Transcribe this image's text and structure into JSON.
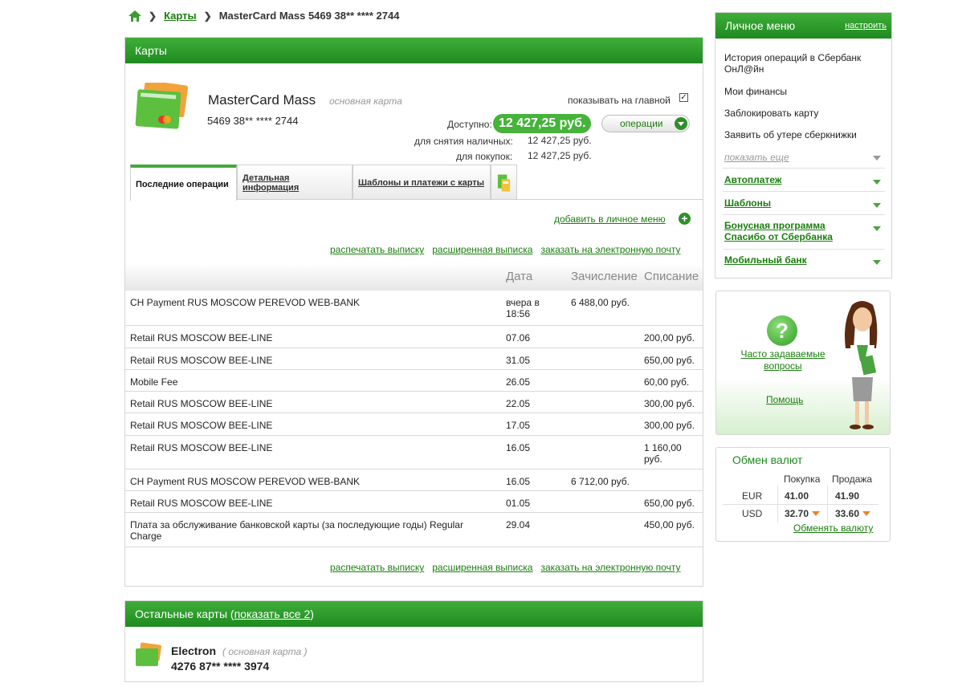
{
  "breadcrumb": {
    "cards_link": "Карты",
    "current": "MasterCard Mass 5469 38** **** 2744"
  },
  "main_panel": {
    "title": "Карты",
    "card_name": "MasterCard Mass",
    "card_type": "основная карта",
    "card_number": "5469 38** **** 2744",
    "show_on_main_label": "показывать на главной",
    "available_label": "Доступно:",
    "available_value": "12 427,25 руб.",
    "operations_button": "операции",
    "cash_label": "для снятия наличных:",
    "cash_value": "12 427,25 руб.",
    "purchase_label": "для покупок:",
    "purchase_value": "12 427,25 руб.",
    "tabs": [
      {
        "label": "Последние операции"
      },
      {
        "label": "Детальная информация"
      },
      {
        "label": "Шаблоны и платежи с карты"
      }
    ],
    "add_to_menu": "добавить в личное меню",
    "links": {
      "print": "распечатать выписку",
      "extended": "расширенная выписка",
      "email": "заказать на электронную почту"
    },
    "table": {
      "headers": {
        "date": "Дата",
        "credit": "Зачисление",
        "debit": "Списание"
      },
      "rows": [
        {
          "desc": "CH Payment RUS MOSCOW PEREVOD WEB-BANK",
          "date": "вчера в 18:56",
          "credit": "6 488,00 руб.",
          "debit": ""
        },
        {
          "desc": "Retail RUS MOSCOW BEE-LINE",
          "date": "07.06",
          "credit": "",
          "debit": "200,00 руб."
        },
        {
          "desc": "Retail RUS MOSCOW BEE-LINE",
          "date": "31.05",
          "credit": "",
          "debit": "650,00 руб."
        },
        {
          "desc": "Mobile Fee",
          "date": "26.05",
          "credit": "",
          "debit": "60,00 руб."
        },
        {
          "desc": "Retail RUS MOSCOW BEE-LINE",
          "date": "22.05",
          "credit": "",
          "debit": "300,00 руб."
        },
        {
          "desc": "Retail RUS MOSCOW BEE-LINE",
          "date": "17.05",
          "credit": "",
          "debit": "300,00 руб."
        },
        {
          "desc": "Retail RUS MOSCOW BEE-LINE",
          "date": "16.05",
          "credit": "",
          "debit": "1 160,00 руб."
        },
        {
          "desc": "CH Payment RUS MOSCOW PEREVOD WEB-BANK",
          "date": "16.05",
          "credit": "6 712,00 руб.",
          "debit": ""
        },
        {
          "desc": "Retail RUS MOSCOW BEE-LINE",
          "date": "01.05",
          "credit": "",
          "debit": "650,00 руб."
        },
        {
          "desc": "Плата за обслуживание банковской карты (за последующие годы) Regular Charge",
          "date": "29.04",
          "credit": "",
          "debit": "450,00 руб."
        }
      ]
    }
  },
  "other_cards": {
    "title_prefix": "Остальные карты (",
    "show_all": "показать все 2",
    "title_suffix": ")",
    "card_name": "Electron",
    "card_type": "( основная карта )",
    "card_number": "4276 87** **** 3974"
  },
  "personal_menu": {
    "title": "Личное меню",
    "configure": "настроить",
    "items": [
      "История операций в Сбербанк ОнЛ@йн",
      "Мои финансы",
      "Заблокировать карту",
      "Заявить об утере сберкнижки"
    ],
    "show_more": "показать еще",
    "sections": [
      "Автоплатеж",
      "Шаблоны",
      "Бонусная программа Спасибо от Сбербанка",
      "Мобильный банк"
    ]
  },
  "help_box": {
    "faq": "Часто задаваемые вопросы",
    "help": "Помощь"
  },
  "currency": {
    "title": "Обмен валют",
    "buy_label": "Покупка",
    "sell_label": "Продажа",
    "rows": [
      {
        "code": "EUR",
        "buy": "41.00",
        "sell": "41.90"
      },
      {
        "code": "USD",
        "buy": "32.70",
        "sell": "33.60"
      }
    ],
    "exchange_link": "Обменять валюту"
  },
  "colors": {
    "brand_green": "#1f8a20",
    "link_green": "#1a7d0e",
    "arrow_orange": "#e8862a"
  }
}
